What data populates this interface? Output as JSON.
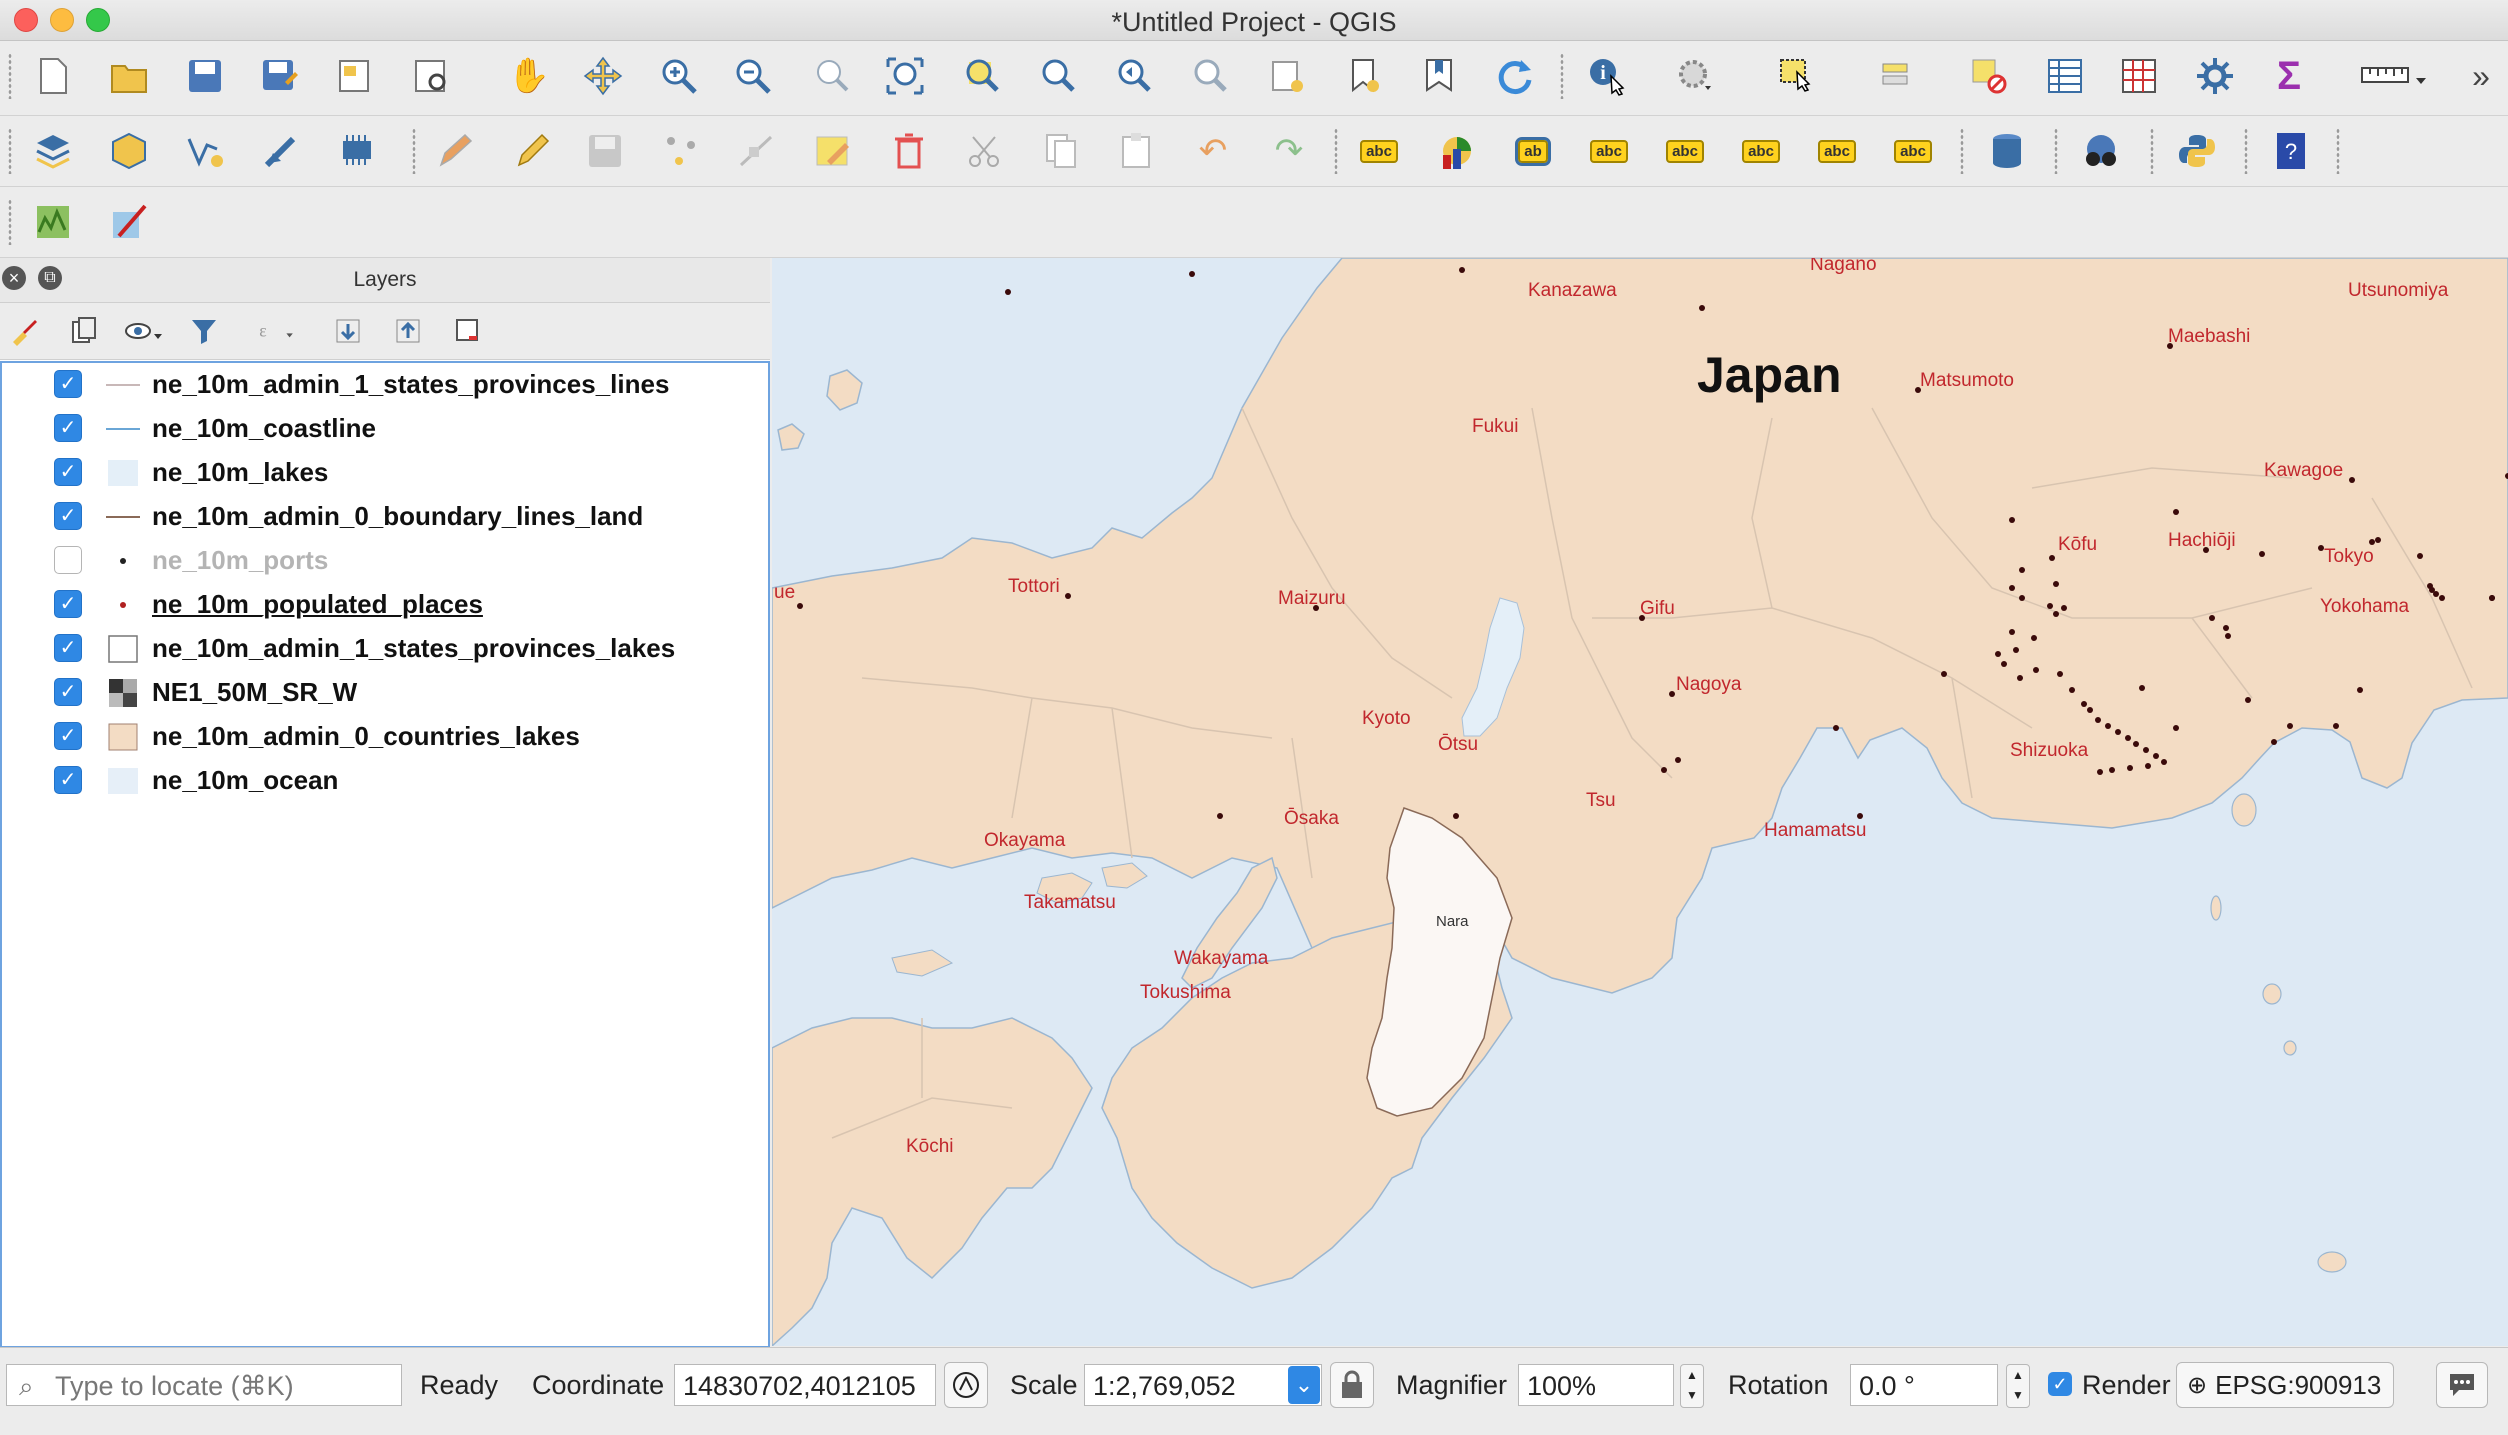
{
  "window": {
    "title": "*Untitled Project - QGIS"
  },
  "toolbar1": {
    "icons": [
      "new-project-icon",
      "open-project-icon",
      "save-project-icon",
      "save-as-icon",
      "new-print-layout-icon",
      "layout-manager-icon",
      "pan-map-icon",
      "pan-to-selection-icon",
      "zoom-in-icon",
      "zoom-out-icon",
      "zoom-native-icon",
      "zoom-full-icon",
      "zoom-to-selection-icon",
      "zoom-to-layer-icon",
      "zoom-last-icon",
      "zoom-next-icon",
      "new-map-view-icon",
      "new-bookmark-icon",
      "show-bookmarks-icon",
      "refresh-icon",
      "identify-features-icon",
      "run-feature-action-icon",
      "select-features-icon",
      "deselect-icon",
      "attribute-table-icon",
      "field-calculator-icon",
      "processing-toolbox-icon",
      "statistical-summary-icon",
      "measure-line-icon",
      "more-tools-icon"
    ]
  },
  "toolbar2": {
    "icons": [
      "data-source-manager-icon",
      "new-geopackage-layer-icon",
      "add-vector-layer-icon",
      "add-raster-layer-icon",
      "add-memory-layer-icon",
      "current-edits-icon",
      "toggle-editing-icon",
      "save-layer-edits-icon",
      "digitize-icon",
      "vertex-tool-icon",
      "modify-attributes-icon",
      "delete-selected-icon",
      "cut-features-icon",
      "copy-features-icon",
      "paste-features-icon",
      "undo-icon",
      "redo-icon",
      "label-icon",
      "diagram-icon",
      "pin-labels-icon",
      "highlight-pinned-labels-icon",
      "show-hide-labels-icon",
      "move-label-icon",
      "rotate-label-icon",
      "change-label-icon",
      "db-manager-icon",
      "metasearch-icon",
      "python-console-icon",
      "whats-this-icon"
    ]
  },
  "toolbar3": {
    "icons": [
      "grass-tools-icon",
      "georeferencer-icon"
    ]
  },
  "layers_panel": {
    "title": "Layers",
    "layers": [
      {
        "name": "ne_10m_admin_1_states_provinces_lines",
        "checked": true,
        "symbol": "line-thin"
      },
      {
        "name": "ne_10m_coastline",
        "checked": true,
        "symbol": "line-blue"
      },
      {
        "name": "ne_10m_lakes",
        "checked": true,
        "symbol": "fill-lightblue"
      },
      {
        "name": "ne_10m_admin_0_boundary_lines_land",
        "checked": true,
        "symbol": "line-brown"
      },
      {
        "name": "ne_10m_ports",
        "checked": false,
        "symbol": "point-black"
      },
      {
        "name": "ne_10m_populated_places",
        "checked": true,
        "symbol": "point-red"
      },
      {
        "name": "ne_10m_admin_1_states_provinces_lakes",
        "checked": true,
        "symbol": "fill-white"
      },
      {
        "name": "NE1_50M_SR_W",
        "checked": true,
        "symbol": "raster"
      },
      {
        "name": "ne_10m_admin_0_countries_lakes",
        "checked": true,
        "symbol": "fill-peach"
      },
      {
        "name": "ne_10m_ocean",
        "checked": true,
        "symbol": "fill-ocean"
      }
    ]
  },
  "map": {
    "country_label": "Japan",
    "region_label": "Nara",
    "places": [
      "Kanazawa",
      "Nagano",
      "Utsunomiya",
      "Maebashi",
      "Matsumoto",
      "Fukui",
      "Kawagoe",
      "Kōfu",
      "Hachiōji",
      "Tokyo",
      "Yokohama",
      "Tottori",
      "Maizuru",
      "Gifu",
      "Nagoya",
      "Kyoto",
      "Ōtsu",
      "Shizuoka",
      "Tsu",
      "Hamamatsu",
      "Ōsaka",
      "Okayama",
      "Takamatsu",
      "Wakayama",
      "Tokushima",
      "Kōchi",
      "ue"
    ],
    "colors": {
      "ocean": "#dde9f4",
      "land": "#f3dcc4",
      "place_label": "#c1272d",
      "nara_fill": "#fbf7f4"
    }
  },
  "statusbar": {
    "locate_placeholder": "Type to locate (⌘K)",
    "status": "Ready",
    "coordinate_label": "Coordinate",
    "coordinate_value": "14830702,4012105",
    "scale_label": "Scale",
    "scale_value": "1:2,769,052",
    "magnifier_label": "Magnifier",
    "magnifier_value": "100%",
    "rotation_label": "Rotation",
    "rotation_value": "0.0 °",
    "render_label": "Render",
    "render_checked": true,
    "crs": "EPSG:900913"
  }
}
